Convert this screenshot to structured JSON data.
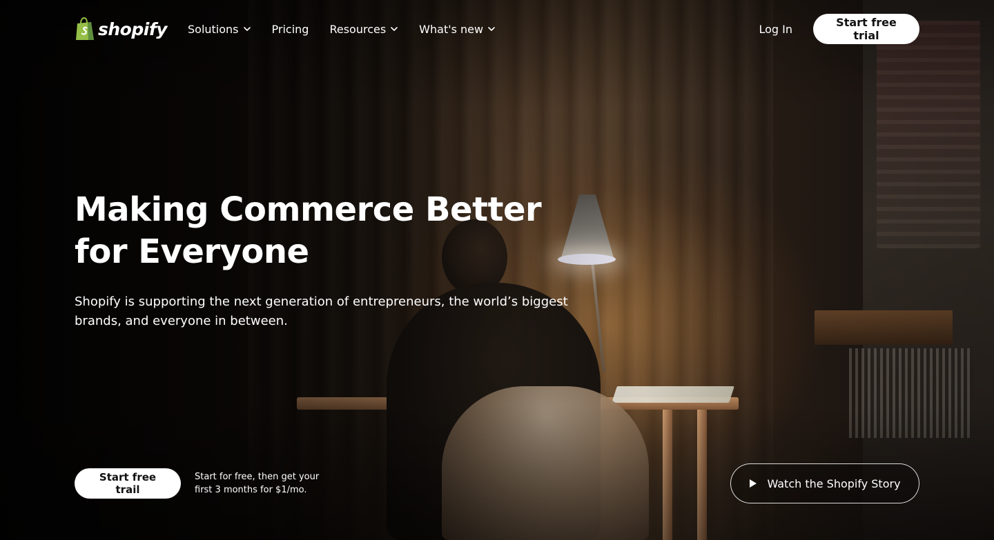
{
  "header": {
    "logo_text": "shopify",
    "nav": [
      {
        "label": "Solutions",
        "has_dropdown": true
      },
      {
        "label": "Pricing",
        "has_dropdown": false
      },
      {
        "label": "Resources",
        "has_dropdown": true
      },
      {
        "label": "What's new",
        "has_dropdown": true
      }
    ],
    "login_label": "Log In",
    "cta_label": "Start free trial"
  },
  "hero": {
    "title": "Making Commerce Better for Everyone",
    "subtitle": "Shopify is supporting the next generation of entrepreneurs, the world’s biggest brands, and everyone in between.",
    "cta_label": "Start free trail",
    "cta_note": "Start for free, then get your first 3 months for $1/mo.",
    "video_label": "Watch the Shopify Story"
  },
  "colors": {
    "brand_green": "#95BF47",
    "brand_dark_green": "#5E8E3E",
    "button_bg": "#FFFFFF",
    "button_text": "#111111"
  },
  "icons": {
    "logo": "shopping-bag-icon",
    "dropdown": "chevron-down-icon",
    "video": "play-icon"
  }
}
